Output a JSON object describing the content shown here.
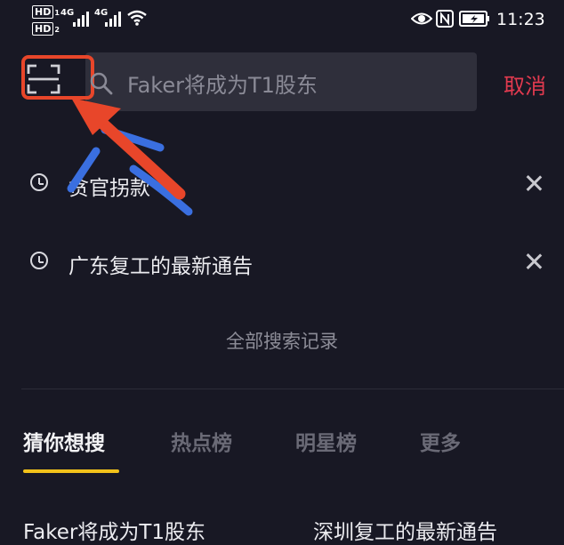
{
  "status_bar": {
    "sim1": "HD",
    "sim1_index": "1",
    "sim2": "HD",
    "sim2_index": "2",
    "net1": "4G",
    "net2": "4G",
    "time": "11:23"
  },
  "search": {
    "placeholder": "Faker将成为T1股东",
    "cancel_label": "取消"
  },
  "history": {
    "items": [
      {
        "label": "贪官拐款"
      },
      {
        "label": "广东复工的最新通告"
      }
    ],
    "all_label": "全部搜索记录"
  },
  "tabs": [
    {
      "label": "猜你想搜",
      "active": true
    },
    {
      "label": "热点榜",
      "active": false
    },
    {
      "label": "明星榜",
      "active": false
    },
    {
      "label": "更多",
      "active": false
    }
  ],
  "suggestions": [
    {
      "label": "Faker将成为T1股东"
    },
    {
      "label": "深圳复工的最新通告"
    }
  ],
  "colors": {
    "background": "#181824",
    "highlight_box": "#e8462a",
    "cancel": "#e23a4f",
    "tab_underline": "#f2c21a",
    "scribble": "#3a6fe0"
  }
}
